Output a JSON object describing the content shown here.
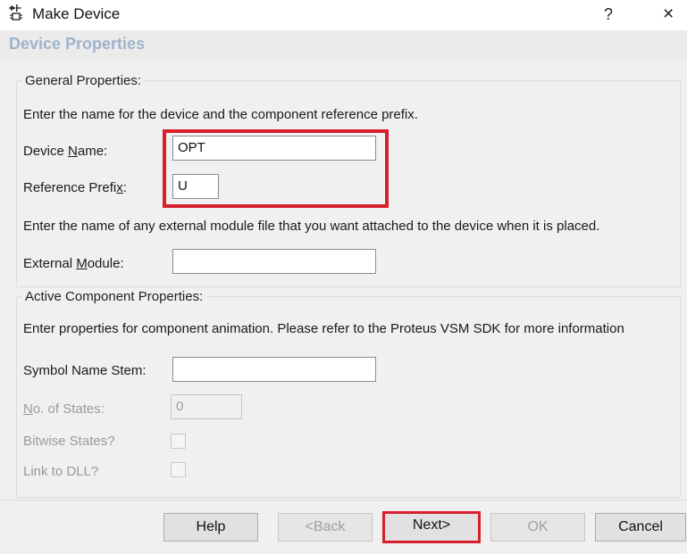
{
  "window": {
    "title": "Make Device",
    "help_label": "?",
    "close_label": "×"
  },
  "page": {
    "heading": "Device Properties"
  },
  "general": {
    "legend": "General Properties:",
    "intro": "Enter the name for the device and the component reference prefix.",
    "device_name": {
      "label_pre": "Device ",
      "label_key": "N",
      "label_post": "ame:",
      "value": "OPT"
    },
    "reference_prefix": {
      "label_pre": "Reference Prefi",
      "label_key": "x",
      "label_post": ":",
      "value": "U"
    },
    "module_intro": "Enter the name of any external module file that you want attached to the device when it is placed.",
    "external_module": {
      "label_pre": "External ",
      "label_key": "M",
      "label_post": "odule:",
      "value": ""
    }
  },
  "active": {
    "legend": "Active Component Properties:",
    "intro": "Enter properties for component animation. Please refer to the Proteus VSM SDK for more information",
    "symbol_stem": {
      "label": "Symbol Name Stem:",
      "value": ""
    },
    "num_states": {
      "label_key": "N",
      "label_post": "o. of States:",
      "value": "0"
    },
    "bitwise": {
      "label": "Bitwise States?",
      "checked": false
    },
    "link_dll": {
      "label": "Link to DLL?",
      "checked": false
    }
  },
  "buttons": {
    "help": "Help",
    "back": "<Back",
    "next": "Next>",
    "ok": "OK",
    "cancel": "Cancel"
  }
}
